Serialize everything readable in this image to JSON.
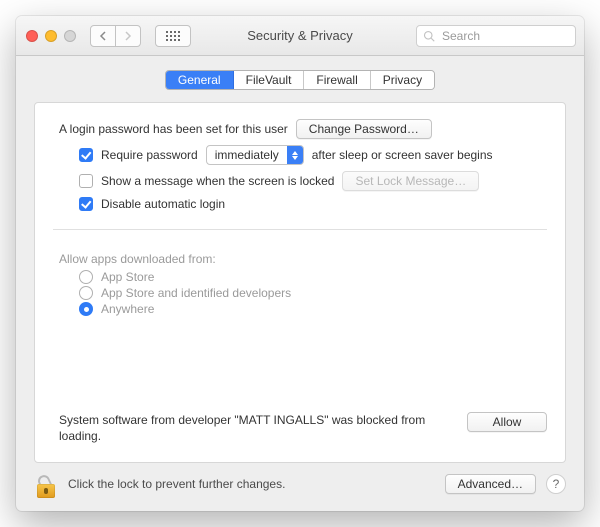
{
  "window": {
    "title": "Security & Privacy"
  },
  "search": {
    "placeholder": "Search"
  },
  "tabs": {
    "general": "General",
    "filevault": "FileVault",
    "firewall": "Firewall",
    "privacy": "Privacy"
  },
  "login": {
    "set_text": "A login password has been set for this user",
    "change_btn": "Change Password…",
    "require_label": "Require password",
    "require_select": "immediately",
    "require_after": "after sleep or screen saver begins",
    "show_msg_label": "Show a message when the screen is locked",
    "set_lock_btn": "Set Lock Message…",
    "disable_auto": "Disable automatic login"
  },
  "download": {
    "header": "Allow apps downloaded from:",
    "opt1": "App Store",
    "opt2": "App Store and identified developers",
    "opt3": "Anywhere"
  },
  "blocked": {
    "message": "System software from developer \"MATT INGALLS\" was blocked from loading.",
    "allow_btn": "Allow"
  },
  "footer": {
    "lock_text": "Click the lock to prevent further changes.",
    "advanced_btn": "Advanced…"
  }
}
